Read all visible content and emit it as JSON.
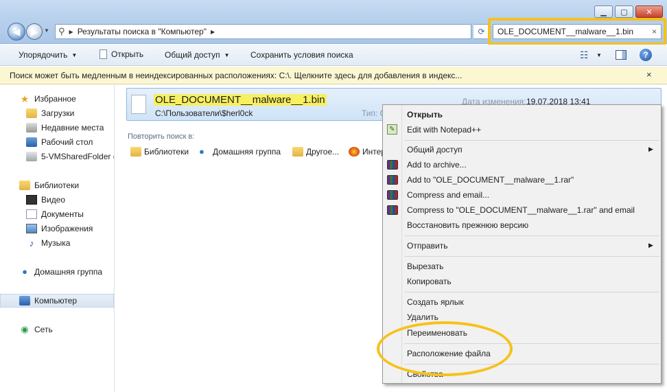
{
  "address": {
    "path": [
      "Результаты поиска в \"Компьютер\""
    ]
  },
  "search": {
    "value": "OLE_DOCUMENT__malware__1.bin",
    "clear": "×"
  },
  "toolbar": {
    "organize": "Упорядочить",
    "open": "Открыть",
    "share": "Общий доступ",
    "save_search": "Сохранить условия поиска"
  },
  "infobar": {
    "text": "Поиск может быть медленным в неиндексированных расположениях: C:\\. Щелкните здесь для добавления в индекс...",
    "close": "×"
  },
  "sidebar": {
    "favorites": "Избранное",
    "fav_items": [
      "Загрузки",
      "Недавние места",
      "Рабочий стол",
      "5-VMSharedFolder (\\"
    ],
    "libraries": "Библиотеки",
    "lib_items": [
      "Видео",
      "Документы",
      "Изображения",
      "Музыка"
    ],
    "homegroup": "Домашняя группа",
    "computer": "Компьютер",
    "network": "Сеть"
  },
  "result": {
    "name": "OLE_DOCUMENT__malware__1.bin",
    "path": "C:\\Пользователи\\$herl0ck",
    "date_label": "Дата изменения:",
    "date": "19.07.2018 13:41",
    "type_label": "Тип: C"
  },
  "repeat": {
    "label": "Повторить поиск в:",
    "links": [
      "Библиотеки",
      "Домашняя группа",
      "Другое...",
      "Интер"
    ]
  },
  "context_menu": {
    "open": "Открыть",
    "notepad": "Edit with Notepad++",
    "share": "Общий доступ",
    "add_archive": "Add to archive...",
    "add_rar": "Add to \"OLE_DOCUMENT__malware__1.rar\"",
    "compress_email": "Compress and email...",
    "compress_rar_email": "Compress to \"OLE_DOCUMENT__malware__1.rar\" and email",
    "restore": "Восстановить прежнюю версию",
    "send_to": "Отправить",
    "cut": "Вырезать",
    "copy": "Копировать",
    "shortcut": "Создать ярлык",
    "delete": "Удалить",
    "rename": "Переименовать",
    "location": "Расположение файла",
    "properties": "Свойства"
  },
  "colors": {
    "highlight": "#f5c21b",
    "selection": "#cfe3f8",
    "infobar": "#fcf7d3"
  }
}
